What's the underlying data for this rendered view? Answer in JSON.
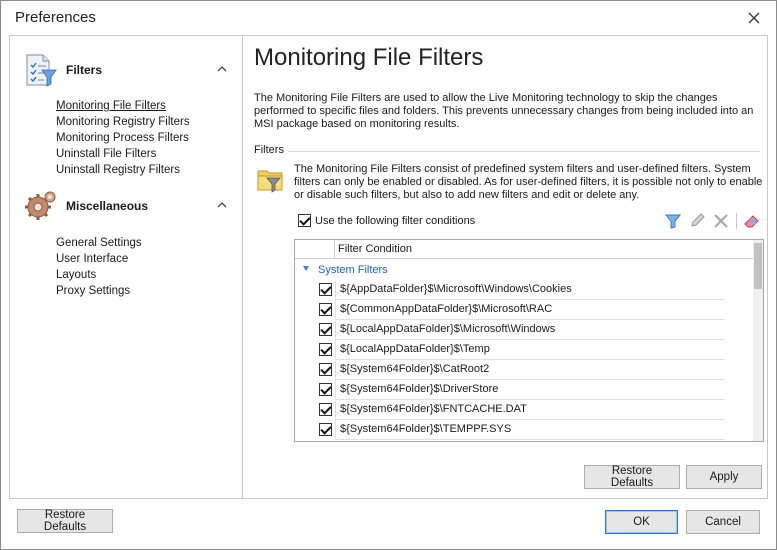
{
  "window": {
    "title": "Preferences"
  },
  "sidebar": {
    "groups": [
      {
        "label": "Filters",
        "icon": "checklist-icon",
        "items": [
          {
            "label": "Monitoring File Filters",
            "active": true
          },
          {
            "label": "Monitoring Registry Filters"
          },
          {
            "label": "Monitoring Process Filters"
          },
          {
            "label": "Uninstall File Filters"
          },
          {
            "label": "Uninstall Registry Filters"
          }
        ]
      },
      {
        "label": "Miscellaneous",
        "icon": "gears-icon",
        "items": [
          {
            "label": "General Settings"
          },
          {
            "label": "User Interface"
          },
          {
            "label": "Layouts"
          },
          {
            "label": "Proxy Settings"
          }
        ]
      }
    ]
  },
  "main": {
    "title": "Monitoring File Filters",
    "description": "The Monitoring File Filters are used to allow the Live Monitoring technology to skip the changes performed to specific files and folders. This prevents unnecessary changes from being included into an MSI package based on monitoring results.",
    "section_label": "Filters",
    "filters_description": "The Monitoring File Filters consist of predefined system filters and user-defined filters. System filters can only be enabled or disabled. As for user-defined filters, it is possible not only to enable or disable such filters, but also to add new filters and edit or delete any.",
    "use_conditions": {
      "label": "Use the following filter conditions",
      "checked": true
    },
    "toolbar": [
      "filter-add-icon",
      "pencil-icon",
      "delete-x-icon",
      "eraser-icon"
    ],
    "grid": {
      "column_header": "Filter Condition",
      "group_label": "System Filters",
      "rows": [
        {
          "value": "${AppDataFolder}$\\Microsoft\\Windows\\Cookies",
          "checked": true
        },
        {
          "value": "${CommonAppDataFolder}$\\Microsoft\\RAC",
          "checked": true
        },
        {
          "value": "${LocalAppDataFolder}$\\Microsoft\\Windows",
          "checked": true
        },
        {
          "value": "${LocalAppDataFolder}$\\Temp",
          "checked": true
        },
        {
          "value": "${System64Folder}$\\CatRoot2",
          "checked": true
        },
        {
          "value": "${System64Folder}$\\DriverStore",
          "checked": true
        },
        {
          "value": "${System64Folder}$\\FNTCACHE.DAT",
          "checked": true
        },
        {
          "value": "${System64Folder}$\\TEMPPF.SYS",
          "checked": true
        }
      ]
    },
    "restore_defaults_label": "Restore Defaults",
    "apply_label": "Apply"
  },
  "footer": {
    "restore_defaults_label": "Restore Defaults",
    "ok_label": "OK",
    "cancel_label": "Cancel"
  },
  "colors": {
    "accent": "#1e63b5",
    "primary_border": "#2b78cf",
    "button_bg": "#e6e6e6"
  }
}
